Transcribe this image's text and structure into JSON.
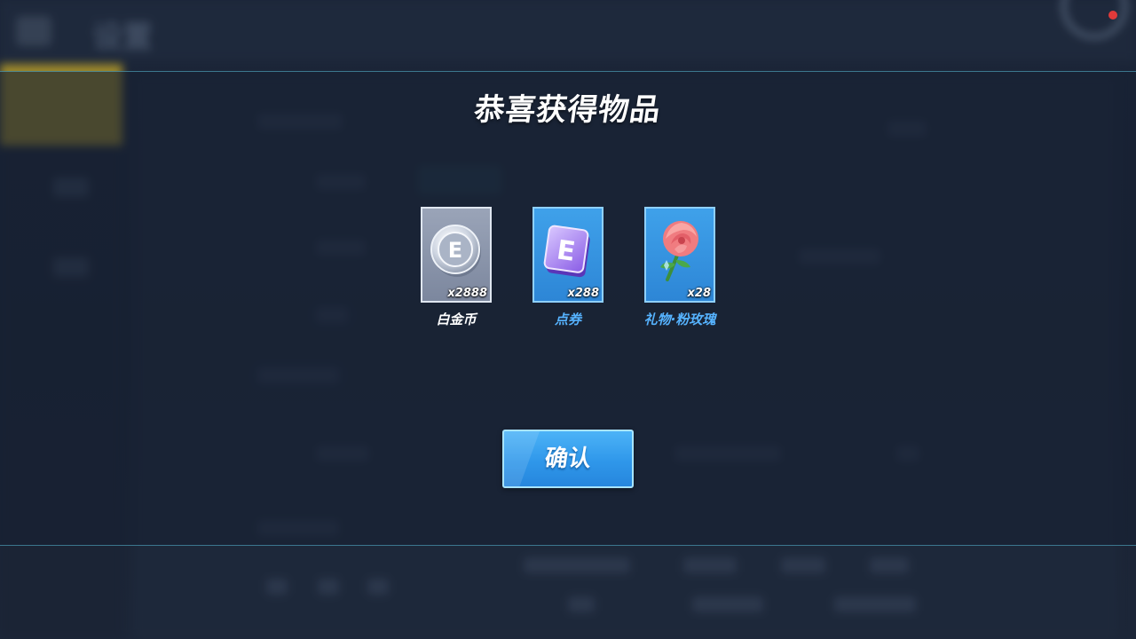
{
  "background": {
    "page_title": "设置"
  },
  "modal": {
    "title": "恭喜获得物品",
    "rewards": [
      {
        "name": "白金币",
        "quantity": "x2888",
        "icon": "platinum-coin-icon",
        "tile_color": "#8a94aa",
        "name_color": "#ffffff"
      },
      {
        "name": "点券",
        "quantity": "x288",
        "icon": "voucher-icon",
        "tile_color": "#3a97e3",
        "name_color": "#56b3ff"
      },
      {
        "name": "礼物·粉玫瑰",
        "quantity": "x28",
        "icon": "pink-rose-icon",
        "tile_color": "#3a97e3",
        "name_color": "#56b3ff"
      }
    ],
    "confirm_label": "确认"
  },
  "colors": {
    "accent_blue": "#2f97ea",
    "band_border": "#5abed7",
    "notification_dot": "#e03a3a"
  }
}
